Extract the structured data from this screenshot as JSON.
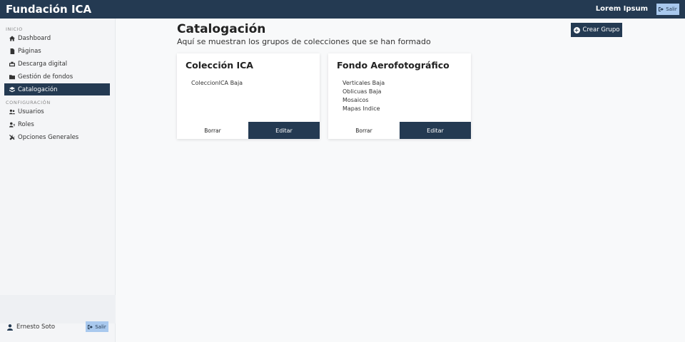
{
  "header": {
    "brand": "Fundación ICA",
    "user": "Lorem Ipsum",
    "exit_label": "Salir"
  },
  "sidebar": {
    "section_start": "INICIO",
    "section_config": "CONFIGURACIÓN",
    "items": [
      {
        "label": "Dashboard",
        "icon": "home-icon"
      },
      {
        "label": "Páginas",
        "icon": "file-icon"
      },
      {
        "label": "Descarga digital",
        "icon": "download-icon"
      },
      {
        "label": "Gestión de fondos",
        "icon": "folder-icon"
      },
      {
        "label": "Catalogación",
        "icon": "layers-icon",
        "active": true
      }
    ],
    "config_items": [
      {
        "label": "Usuarios",
        "icon": "users-icon"
      },
      {
        "label": "Roles",
        "icon": "user-roles-icon"
      },
      {
        "label": "Opciones Generales",
        "icon": "tools-icon"
      }
    ],
    "footer": {
      "user_name": "Ernesto Soto",
      "exit_label": "Salir"
    }
  },
  "main": {
    "title": "Catalogación",
    "subtitle": "Aquí se muestran los grupos de colecciones que se han formado",
    "create_button": "Crear Grupo",
    "groups": [
      {
        "title": "Colección ICA",
        "items": [
          "ColeccionICA Baja"
        ],
        "delete_label": "Borrar",
        "edit_label": "Editar"
      },
      {
        "title": "Fondo Aerofotográfico",
        "items": [
          "Verticales Baja",
          "Oblicuas Baja",
          "Mosaicos",
          "Mapas Indice"
        ],
        "delete_label": "Borrar",
        "edit_label": "Editar"
      }
    ]
  },
  "colors": {
    "primary": "#243a52",
    "accent": "#a9c9ee",
    "background": "#f8f9fa"
  }
}
